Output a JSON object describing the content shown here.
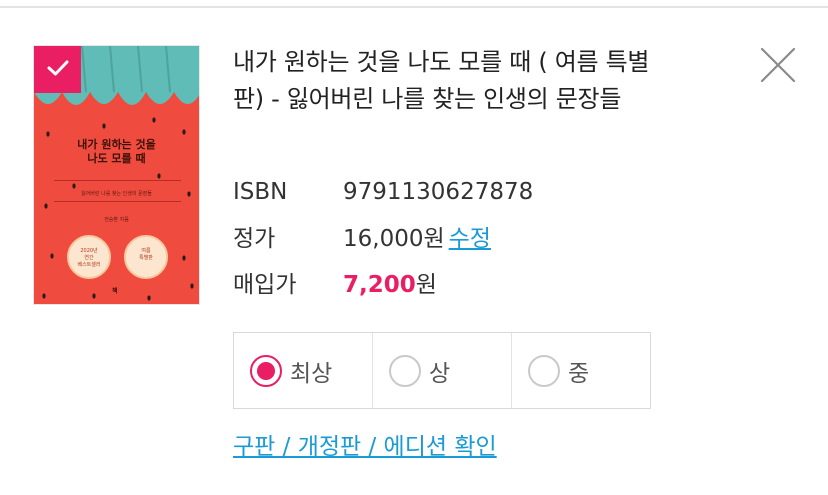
{
  "book": {
    "title": "내가 원하는 것을 나도 모를 때 ( 여름 특별판) - 잃어버린 나를 찾는 인생의 문장들",
    "selected": true,
    "cover": {
      "title": "내가 원하는 것을\n나도 모를 때",
      "subtitle": "잃어버린 나를 찾는 인생의 문장들",
      "author": "전승환 지음",
      "seal_left": "2020년\n연간\n베스트셀러",
      "seal_right": "여름\n특별판",
      "publisher_mark": "책"
    }
  },
  "info": {
    "isbn_label": "ISBN",
    "isbn_value": "9791130627878",
    "price_label": "정가",
    "price_value": "16,000원",
    "edit_label": "수정",
    "buy_label": "매입가",
    "buy_amount": "7,200",
    "buy_unit": "원"
  },
  "condition": {
    "selected_index": 0,
    "options": [
      "최상",
      "상",
      "중"
    ]
  },
  "edition_link": "구판 / 개정판 / 에디션 확인",
  "colors": {
    "accent": "#e91e63",
    "link": "#1a9ad6",
    "cover_red": "#ef4b3f",
    "cover_teal": "#5fbcb6"
  },
  "icons": {
    "close": "close-icon",
    "check": "check-icon"
  }
}
